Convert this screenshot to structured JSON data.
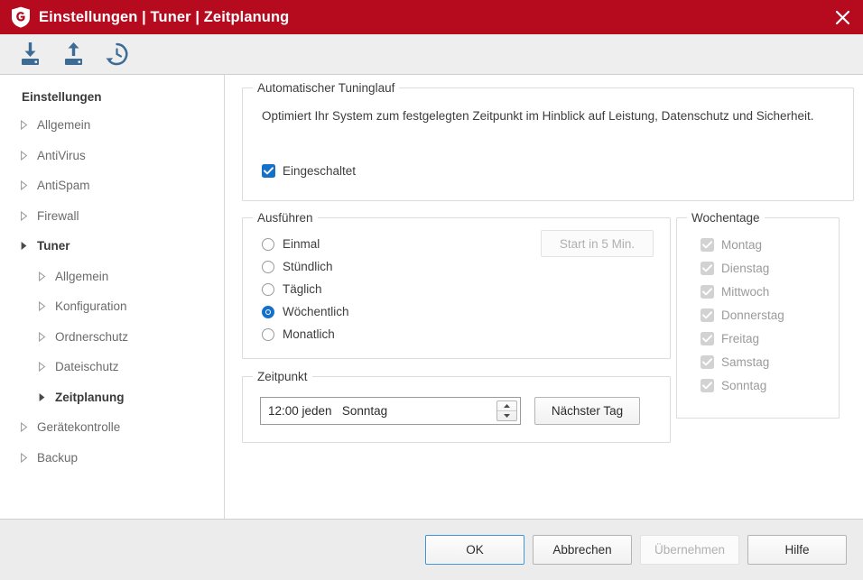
{
  "window": {
    "title": "Einstellungen | Tuner | Zeitplanung",
    "logo_icon": "gdata-shield-logo",
    "close_icon": "close-icon",
    "accent_color": "#b60a1e",
    "highlight_color": "#1470c8"
  },
  "toolbar": {
    "items": [
      {
        "icon": "import-download-icon",
        "name": "import-settings"
      },
      {
        "icon": "export-upload-icon",
        "name": "export-settings"
      },
      {
        "icon": "restore-defaults-clock-icon",
        "name": "restore-defaults"
      }
    ]
  },
  "sidebar": {
    "heading": "Einstellungen",
    "items": [
      {
        "label": "Allgemein",
        "level": 1,
        "selected": false
      },
      {
        "label": "AntiVirus",
        "level": 1,
        "selected": false
      },
      {
        "label": "AntiSpam",
        "level": 1,
        "selected": false
      },
      {
        "label": "Firewall",
        "level": 1,
        "selected": false
      },
      {
        "label": "Tuner",
        "level": 1,
        "selected": true
      },
      {
        "label": "Allgemein",
        "level": 2,
        "selected": false
      },
      {
        "label": "Konfiguration",
        "level": 2,
        "selected": false
      },
      {
        "label": "Ordnerschutz",
        "level": 2,
        "selected": false
      },
      {
        "label": "Dateischutz",
        "level": 2,
        "selected": false
      },
      {
        "label": "Zeitplanung",
        "level": 2,
        "selected": true
      },
      {
        "label": "Gerätekontrolle",
        "level": 1,
        "selected": false
      },
      {
        "label": "Backup",
        "level": 1,
        "selected": false
      }
    ]
  },
  "auto_tuning": {
    "legend": "Automatischer Tuninglauf",
    "description": "Optimiert Ihr System zum festgelegten Zeitpunkt im Hinblick auf Leistung, Datenschutz und Sicherheit.",
    "enabled_label": "Eingeschaltet",
    "enabled_checked": true
  },
  "execute": {
    "legend": "Ausführen",
    "options": [
      {
        "label": "Einmal",
        "selected": false
      },
      {
        "label": "Stündlich",
        "selected": false
      },
      {
        "label": "Täglich",
        "selected": false
      },
      {
        "label": "Wöchentlich",
        "selected": true
      },
      {
        "label": "Monatlich",
        "selected": false
      }
    ],
    "start_button_label": "Start in 5 Min.",
    "start_button_enabled": false
  },
  "weekdays": {
    "legend": "Wochentage",
    "items": [
      {
        "label": "Montag",
        "checked": true,
        "enabled": false
      },
      {
        "label": "Dienstag",
        "checked": true,
        "enabled": false
      },
      {
        "label": "Mittwoch",
        "checked": true,
        "enabled": false
      },
      {
        "label": "Donnerstag",
        "checked": true,
        "enabled": false
      },
      {
        "label": "Freitag",
        "checked": true,
        "enabled": false
      },
      {
        "label": "Samstag",
        "checked": true,
        "enabled": false
      },
      {
        "label": "Sonntag",
        "checked": true,
        "enabled": false
      }
    ]
  },
  "schedule": {
    "legend": "Zeitpunkt",
    "field_value": "12:00 jeden   Sonntag",
    "spinner_up_icon": "spinner-up-icon",
    "spinner_down_icon": "spinner-down-icon",
    "next_day_button_label": "Nächster Tag"
  },
  "footer": {
    "ok_label": "OK",
    "cancel_label": "Abbrechen",
    "apply_label": "Übernehmen",
    "apply_enabled": false,
    "help_label": "Hilfe"
  }
}
